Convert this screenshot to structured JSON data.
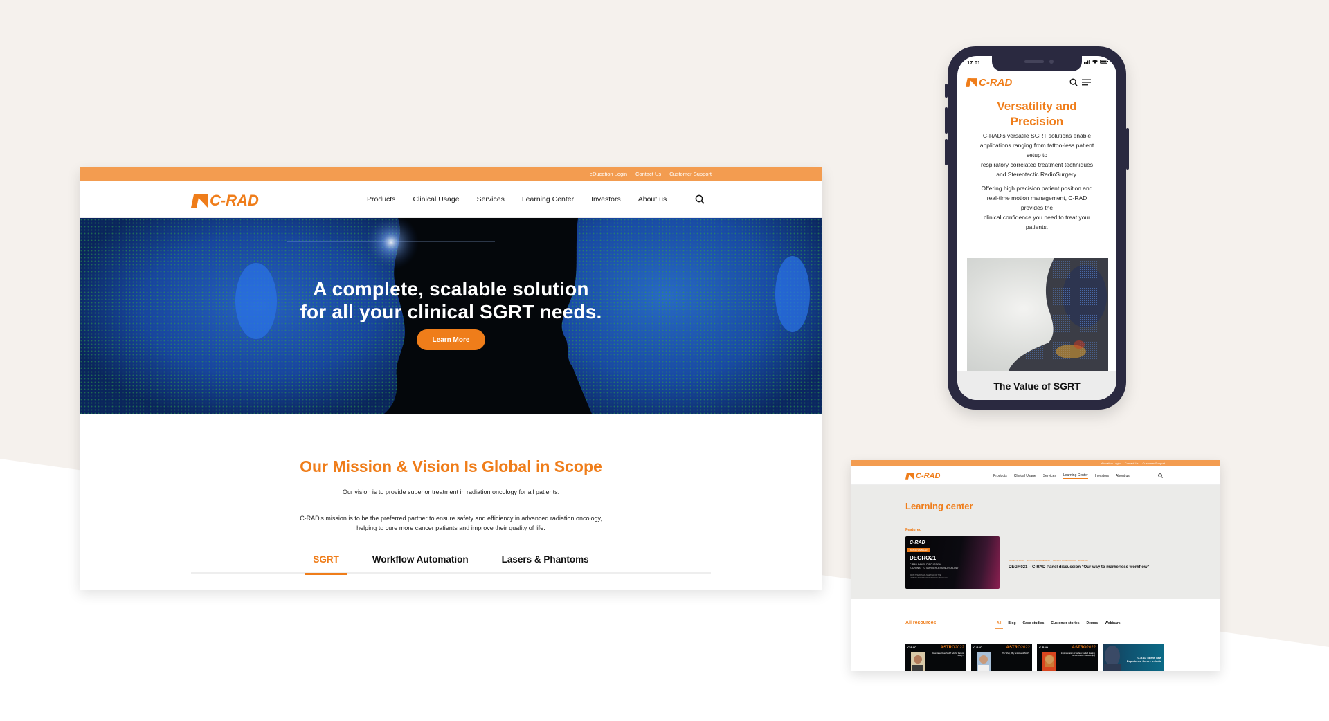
{
  "colors": {
    "brand_orange": "#ef7d1a",
    "topbar_orange": "#f39c50",
    "background_beige": "#f5f1ed",
    "phone_frame": "#2a2940",
    "text_dark": "#222222"
  },
  "desktop": {
    "topbar_links": [
      "eDucation Login",
      "Contact Us",
      "Customer Support"
    ],
    "logo_text": "C-RAD",
    "nav_items": [
      "Products",
      "Clinical Usage",
      "Services",
      "Learning Center",
      "Investors",
      "About us"
    ],
    "search_icon": "search-icon",
    "hero": {
      "title_line1": "A complete, scalable solution",
      "title_line2": "for all your clinical SGRT needs.",
      "cta_label": "Learn More"
    },
    "mission": {
      "heading": "Our Mission & Vision Is Global in Scope",
      "vision": "Our vision is to provide superior treatment in radiation oncology for all patients.",
      "mission_line1": "C-RAD's mission is to be the preferred partner to ensure safety and efficiency in advanced radiation oncology,",
      "mission_line2": "helping to cure more cancer patients and improve their quality of life."
    },
    "tabs": [
      {
        "label": "SGRT",
        "active": true
      },
      {
        "label": "Workflow Automation",
        "active": false
      },
      {
        "label": "Lasers & Phantoms",
        "active": false
      }
    ]
  },
  "phone": {
    "status_time": "17:01",
    "status_icons": [
      "signal-icon",
      "wifi-icon",
      "battery-icon"
    ],
    "logo_text": "C-RAD",
    "title_line1": "Versatility and",
    "title_line2": "Precision",
    "paragraph1": [
      "C-RAD's versatile SGRT solutions enable",
      "applications ranging from tattoo-less patient",
      "setup to",
      "respiratory correlated treatment techniques",
      "and Stereotactic RadioSurgery."
    ],
    "paragraph2": [
      "Offering high precision patient position and",
      "real-time motion management, C-RAD",
      "provides the",
      "clinical confidence you need to treat your",
      "patients."
    ],
    "card_title": "The Value of SGRT"
  },
  "learning_center": {
    "topbar_links": [
      "eDucation Login",
      "Contact Us",
      "Customer Support"
    ],
    "logo_text": "C-RAD",
    "nav_items": [
      "Products",
      "Clinical Usage",
      "Services",
      "Learning Center",
      "Investors",
      "About us"
    ],
    "active_nav": "Learning Center",
    "page_title": "Learning center",
    "featured_label": "Featured",
    "featured_thumb": {
      "logo": "C-RAD",
      "badge": "WATCH WEBINAR",
      "heading": "DEGRO21",
      "subtitle_line1": "C-RAD PANEL DISCUSSION",
      "subtitle_line2": "\"OUR WAY TO MARKERLESS WORKFLOW\"",
      "small_line1": "FROM THE ANNUAL MEETING OF THE",
      "small_line2": "GERMAN SOCIETY OF RADIATION ONCOLOGY"
    },
    "featured_tags": [
      "CATALYST+ HD",
      "MOTION MANAGEMENT",
      "PATIENT POSITIONING",
      "WEBINAR"
    ],
    "featured_title": "DEGR021 – C-RAD Panel discussion \"Our way to markerless workflow\"",
    "all_resources_label": "All resources",
    "filters": [
      {
        "label": "All",
        "active": true
      },
      {
        "label": "Blog",
        "active": false
      },
      {
        "label": "Case studies",
        "active": false
      },
      {
        "label": "Customer stories",
        "active": false
      },
      {
        "label": "Demos",
        "active": false
      },
      {
        "label": "Webinars",
        "active": false
      }
    ],
    "resource_cards": [
      {
        "logo": "C-RAD",
        "event_a": "ASTRO",
        "event_b": "2022",
        "desc": "What Value Does SGRT Add for Patient Safety?"
      },
      {
        "logo": "C-RAD",
        "event_a": "ASTRO",
        "event_b": "2022",
        "desc": "The What, Why and How of SGRT"
      },
      {
        "logo": "C-RAD",
        "event_a": "ASTRO",
        "event_b": "2022",
        "desc": "Implementation of Surface Guided Imaging for Stereotactic Radiosurgery"
      },
      {
        "desc": "C-RAD opens new Experience Centre in India"
      }
    ]
  }
}
